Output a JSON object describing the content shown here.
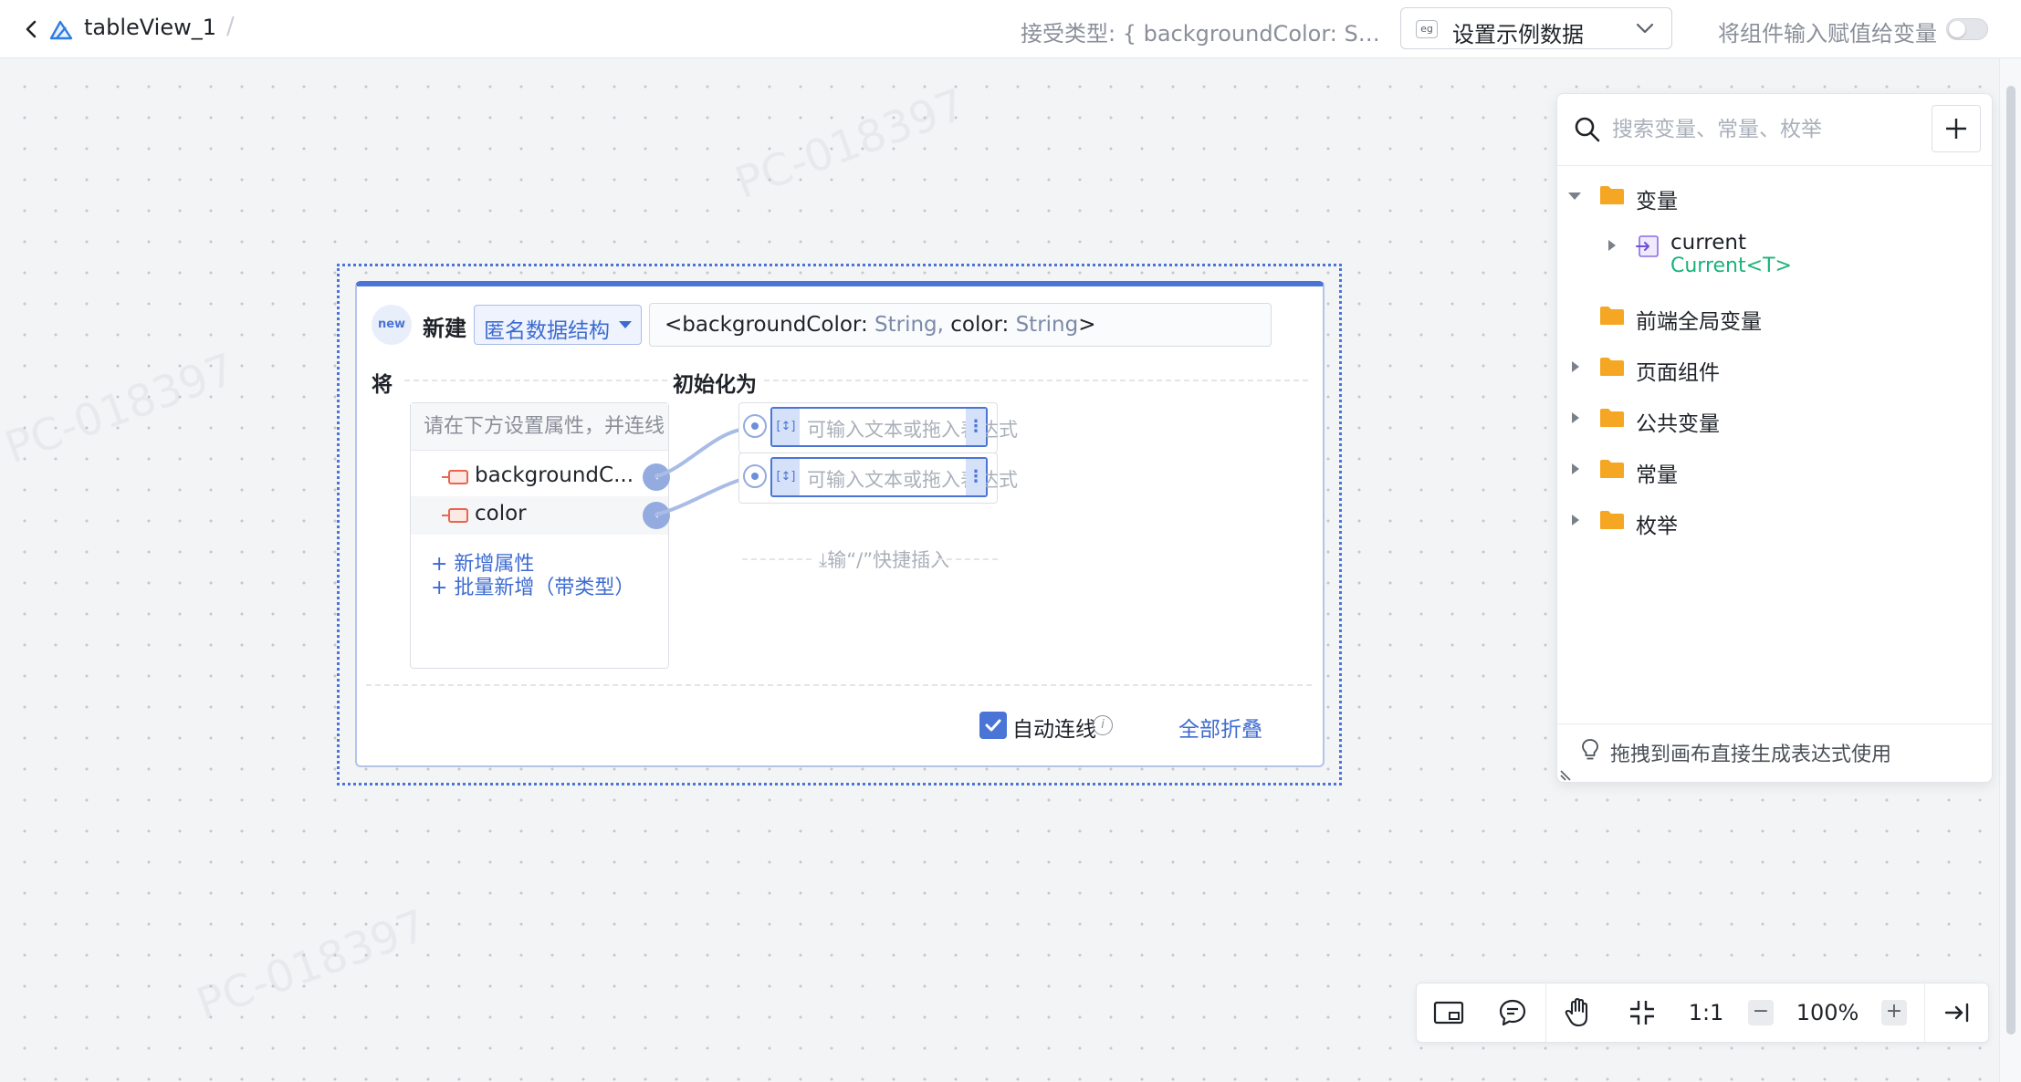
{
  "header": {
    "title": "tableView_1",
    "accept_type": "接受类型: { backgroundColor: Stri...",
    "example_select": {
      "badge": "eg",
      "label": "设置示例数据"
    },
    "assign_label": "将组件输入赋值给变量",
    "assign_toggle": false
  },
  "node": {
    "new_badge": "new",
    "new_label": "新建",
    "struct_type": "匿名数据结构",
    "type_signature": {
      "open": "<backgroundColor: ",
      "t1": "String,",
      "mid": " color: ",
      "t2": "String",
      "close": ">"
    },
    "left_label": "将",
    "right_label": "初始化为",
    "props_hint": "请在下方设置属性，并连线",
    "properties": [
      {
        "name": "backgroundC..."
      },
      {
        "name": "color"
      }
    ],
    "add_property": "+ 新增属性",
    "batch_add": "+ 批量新增（带类型）",
    "expr_icon": "[↕]",
    "expr_placeholder": "可输入文本或拖入表达式",
    "quick_insert": "输“/”快捷插入",
    "auto_connect_label": "自动连线",
    "auto_connect_checked": true,
    "collapse_all": "全部折叠"
  },
  "panel": {
    "search_placeholder": "搜索变量、常量、枚举",
    "tree": [
      {
        "label": "变量",
        "expanded": true
      },
      {
        "label": "current",
        "type": "Current<T>"
      },
      {
        "label": "前端全局变量",
        "expanded": false
      },
      {
        "label": "页面组件",
        "expanded": false
      },
      {
        "label": "公共变量",
        "expanded": false
      },
      {
        "label": "常量",
        "expanded": false
      },
      {
        "label": "枚举",
        "expanded": false
      }
    ],
    "footer_tip": "拖拽到画布直接生成表达式使用"
  },
  "toolbar": {
    "one_to_one": "1:1",
    "zoom_out": "−",
    "zoom": "100%",
    "zoom_in": "+"
  },
  "watermark": "PC-018397",
  "colors": {
    "accent": "#4a74d6",
    "folder": "#f5a623",
    "type_green": "#18b47b"
  }
}
